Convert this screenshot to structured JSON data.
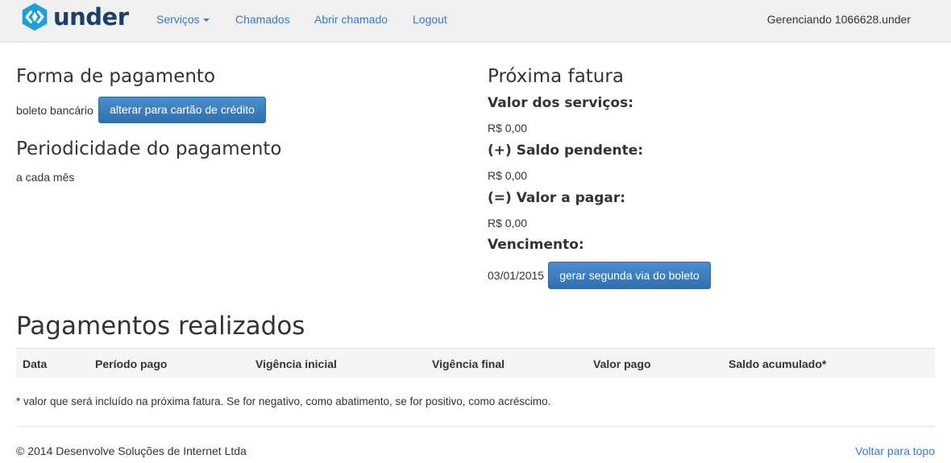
{
  "navbar": {
    "brand": "under",
    "nav_items": [
      "Serviços",
      "Chamados",
      "Abrir chamado",
      "Logout"
    ],
    "user_text": "Gerenciando 1066628.under",
    "colors": {
      "link": "#3a7bbf",
      "brand": "#1d3d6b",
      "logo": "#1e9fdc"
    }
  },
  "payment": {
    "title": "Forma de pagamento",
    "method": "boleto bancário",
    "change_button": "alterar para cartão de crédito"
  },
  "periodicity": {
    "title": "Periodicidade do pagamento",
    "value": "a cada mês"
  },
  "invoice": {
    "title": "Próxima fatura",
    "services_label": "Valor dos serviços:",
    "services_value": "R$ 0,00",
    "pending_label": "(+) Saldo pendente:",
    "pending_value": "R$ 0,00",
    "total_label": "(=) Valor a pagar:",
    "total_value": "R$ 0,00",
    "due_label": "Vencimento:",
    "due_date": "03/01/2015",
    "boleto_button": "gerar segunda via do boleto"
  },
  "payments": {
    "title": "Pagamentos realizados",
    "columns": [
      "Data",
      "Período pago",
      "Vigência inicial",
      "Vigência final",
      "Valor pago",
      "Saldo acumulado*"
    ],
    "note": "* valor que será incluído na próxima fatura. Se for negativo, como abatimento, se for positivo, como acréscimo."
  },
  "footer": {
    "copyright": "© 2014 Desenvolve Soluções de Internet Ltda",
    "back_to_top": "Voltar para topo"
  }
}
